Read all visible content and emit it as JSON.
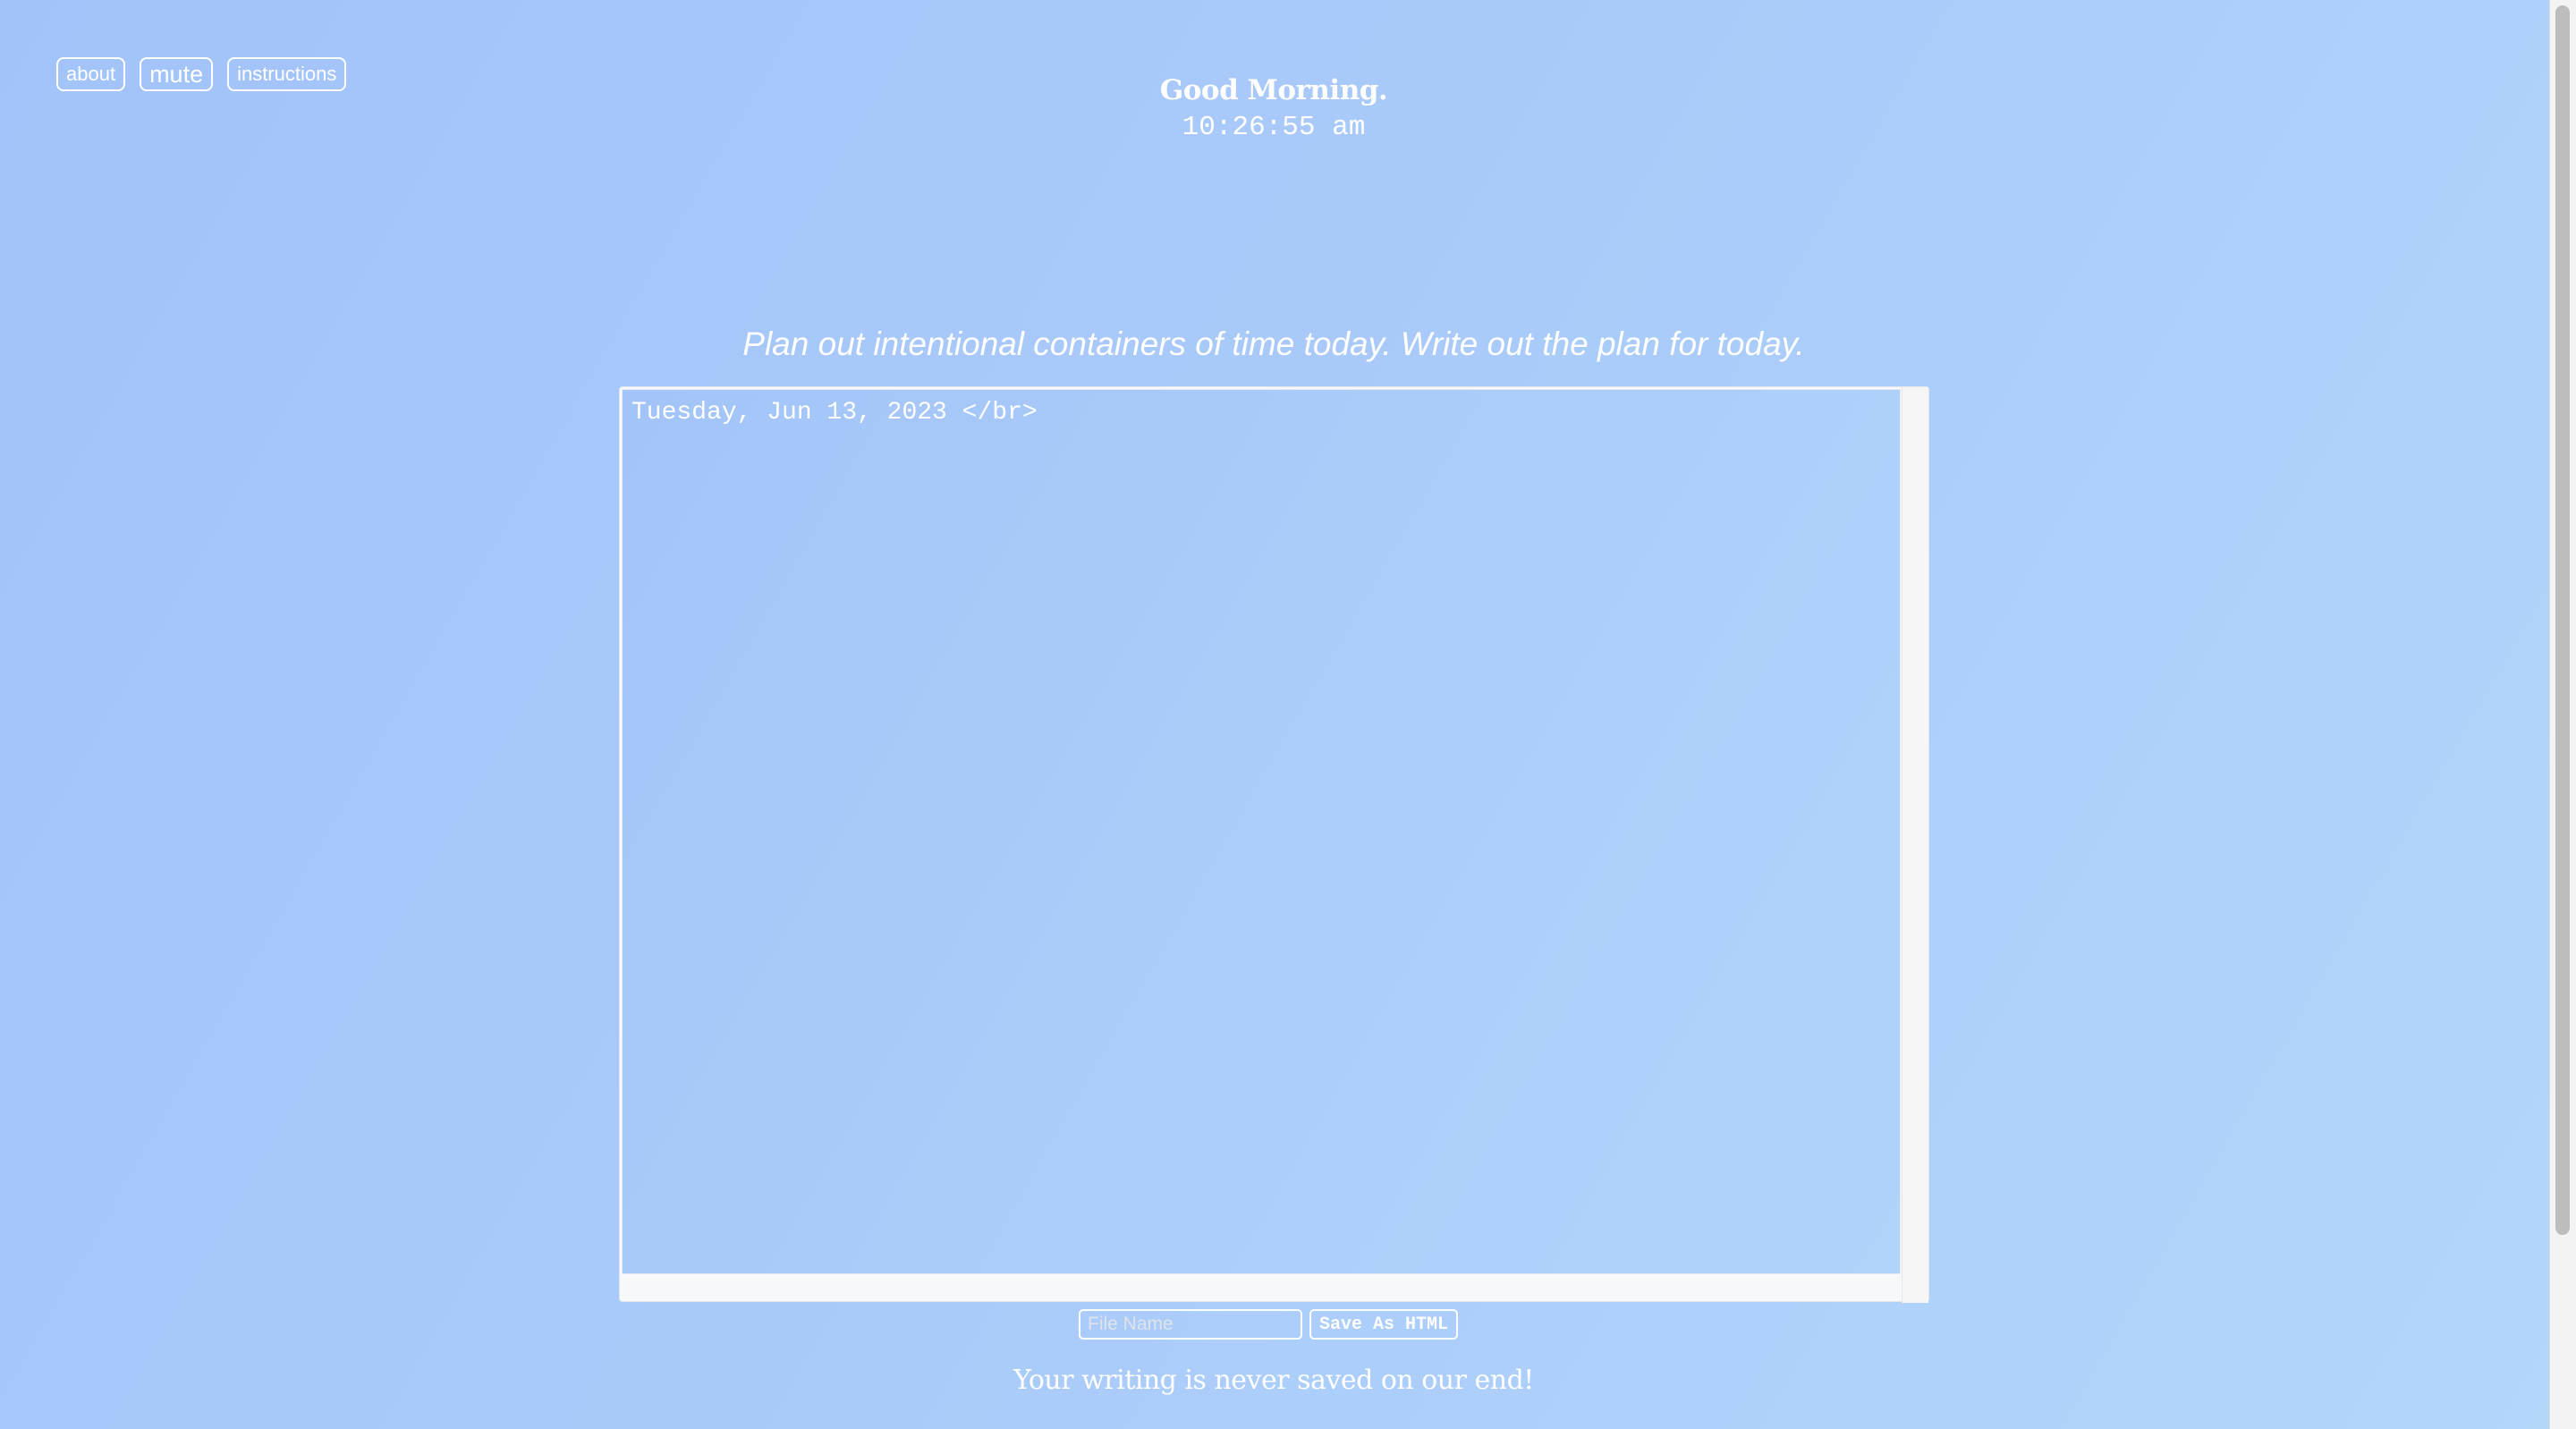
{
  "nav": {
    "about": "about",
    "mute": "mute",
    "instructions": "instructions"
  },
  "header": {
    "greeting": "Good Morning.",
    "time": "10:26:55 am"
  },
  "prompt": "Plan out intentional containers of time today. Write out the plan for today.",
  "editor": {
    "content": "Tuesday, Jun 13, 2023 </br>"
  },
  "save": {
    "filename_placeholder": "File Name",
    "filename_value": "",
    "button": "Save As HTML"
  },
  "footer": {
    "note": "Your writing is never saved on our end!"
  },
  "colors": {
    "background_start": "#a2c3f9",
    "background_end": "#b3d6fb",
    "text": "#ffffff"
  }
}
